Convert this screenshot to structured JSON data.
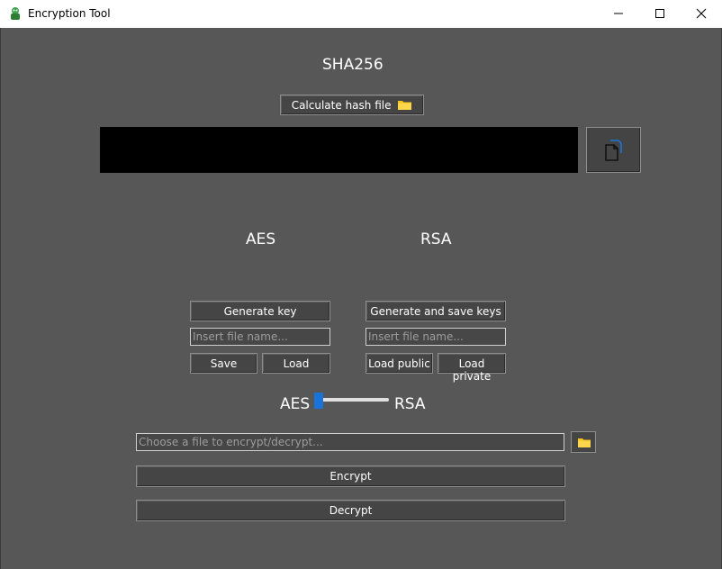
{
  "window": {
    "title": "Encryption Tool",
    "controls": [
      "minimize-icon",
      "maximize-icon",
      "close-icon"
    ]
  },
  "sha": {
    "title": "SHA256",
    "calc_button": "Calculate hash file",
    "hash_value": "",
    "copy_icon": "copy-document-icon"
  },
  "aes": {
    "title": "AES",
    "generate_button": "Generate key",
    "filename_placeholder": "Insert file name...",
    "save_button": "Save",
    "load_button": "Load"
  },
  "rsa": {
    "title": "RSA",
    "generate_button": "Generate and save keys",
    "filename_placeholder": "Insert file name...",
    "load_public_button": "Load public",
    "load_private_button": "Load private"
  },
  "mode": {
    "left_label": "AES",
    "right_label": "RSA",
    "selected": "AES"
  },
  "file": {
    "placeholder": "Choose a file to encrypt/decrypt...",
    "browse_icon": "folder-icon"
  },
  "actions": {
    "encrypt_button": "Encrypt",
    "decrypt_button": "Decrypt"
  },
  "colors": {
    "background": "#575757",
    "accent": "#1a73d9",
    "folder": "#f5c518"
  }
}
